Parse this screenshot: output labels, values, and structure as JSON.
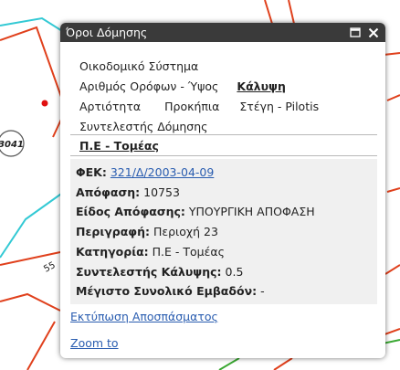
{
  "map": {
    "parcel_labels": [
      "3041",
      "55"
    ]
  },
  "popup": {
    "title": "Όροι Δόμησης",
    "tabs": [
      "Οικοδομικό Σύστημα",
      "Αριθμός Ορόφων - Ύψος",
      "Κάλυψη",
      "Αρτιότητα",
      "Προκήπια",
      "Στέγη - Pilotis",
      "Συντελεστής Δόμησης"
    ],
    "active_tab": "Κάλυψη",
    "section": "Π.Ε - Τομέας",
    "fields": {
      "fek_label": "ΦΕΚ:",
      "fek_value": "321/Δ/2003-04-09",
      "apofasi_label": "Απόφαση:",
      "apofasi_value": "10753",
      "eidos_label": "Είδος Απόφασης:",
      "eidos_value": "ΥΠΟΥΡΓΙΚΗ ΑΠΟΦΑΣΗ",
      "perigrafi_label": "Περιγραφή:",
      "perigrafi_value": "Περιοχή 23",
      "kategoria_label": "Κατηγορία:",
      "kategoria_value": "Π.Ε - Τομέας",
      "kalypsi_label": "Συντελεστής Κάλυψης:",
      "kalypsi_value": "0.5",
      "emvadon_label": "Μέγιστο Συνολικό Εμβαδόν:",
      "emvadon_value": "-"
    },
    "links": {
      "print": "Εκτύπωση Αποσπάσματος",
      "zoom": "Zoom to"
    },
    "icons": [
      "maximize-icon",
      "close-icon"
    ]
  },
  "colors": {
    "parcel_red": "#e0401c",
    "parcel_cyan": "#33c9d4",
    "parcel_green": "#3aa832",
    "title_bar": "#3a3a3a",
    "link": "#2a5db0"
  }
}
